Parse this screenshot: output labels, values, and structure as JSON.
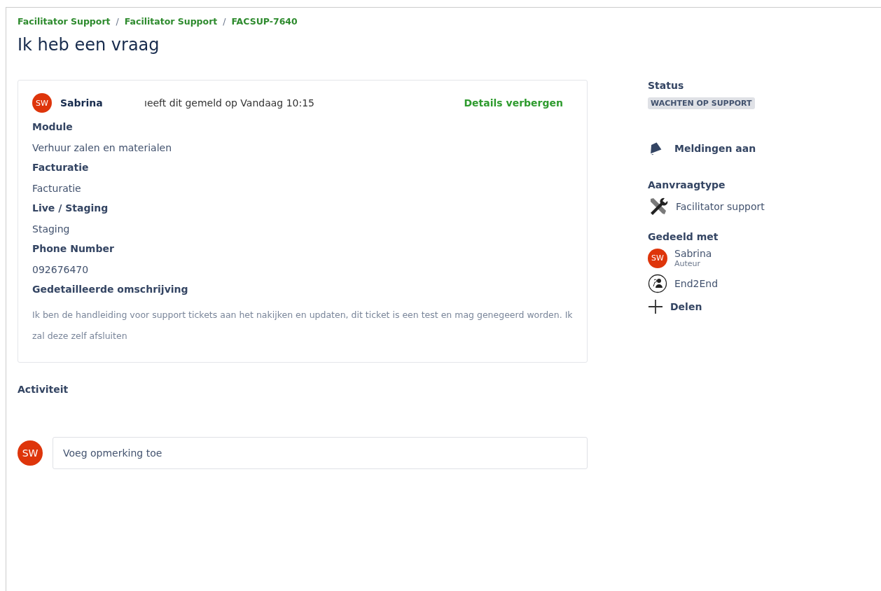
{
  "breadcrumb_separator": "/",
  "breadcrumbs": [
    "Facilitator Support",
    "Facilitator Support",
    "FACSUP-7640"
  ],
  "title": "Ik heb een vraag",
  "request": {
    "avatar": "SW",
    "reporter": "Sabrina",
    "reported": "ıeeft dit gemeld op Vandaag 10:15",
    "toggle": "Details verbergen",
    "fields": [
      {
        "label": "Module",
        "value": "Verhuur zalen en materialen"
      },
      {
        "label": "Facturatie",
        "value": "Facturatie"
      },
      {
        "label": "Live / Staging",
        "value": "Staging"
      },
      {
        "label": "Phone Number",
        "value": "092676470"
      },
      {
        "label": "Gedetailleerde omschrijving",
        "value": "Ik ben de handleiding voor support tickets aan het nakijken en updaten, dit ticket is een test en mag genegeerd worden. Ik zal deze zelf afsluiten"
      }
    ]
  },
  "activity": {
    "title": "Activiteit",
    "avatar": "SW",
    "comment": {
      "placeholder": "Voeg opmerking toe"
    }
  },
  "sidebar": {
    "status_label": "Status",
    "status": "WACHTEN OP SUPPORT",
    "notifications": "Meldingen aan",
    "type_label": "Aanvraagtype",
    "type": "Facilitator support",
    "shared_label": "Gedeeld met",
    "shared": [
      {
        "kind": "user",
        "avatar": "SW",
        "name": "Sabrina",
        "role": "Auteur"
      },
      {
        "kind": "group",
        "name": "End2End"
      }
    ],
    "share": "Delen"
  }
}
